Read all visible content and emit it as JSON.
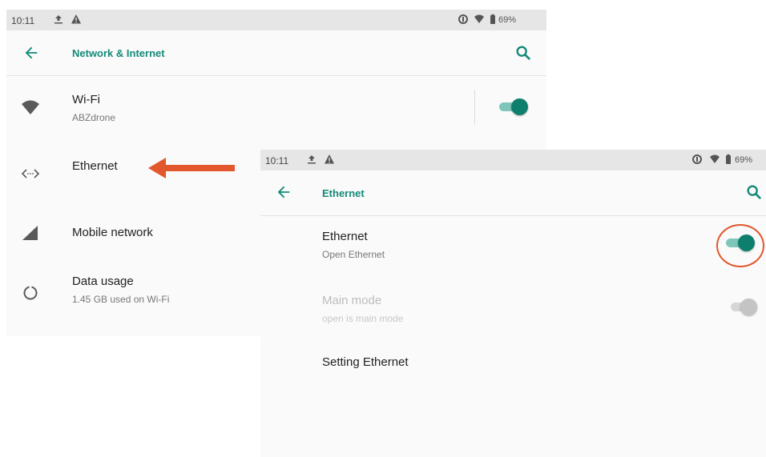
{
  "colors": {
    "accent": "#138a78",
    "switch_on": "#0e7f6d",
    "annotation": "#e2572b"
  },
  "screen1": {
    "status": {
      "time": "10:11",
      "battery": "69%"
    },
    "toolbar": {
      "title": "Network & Internet",
      "back_icon": "arrow-back-icon",
      "search_icon": "search-icon"
    },
    "items": [
      {
        "title": "Wi-Fi",
        "subtitle": "ABZdrone",
        "icon": "wifi-icon",
        "switch": "on"
      },
      {
        "title": "Ethernet",
        "subtitle": "",
        "icon": "ethernet-icon"
      },
      {
        "title": "Mobile network",
        "subtitle": "",
        "icon": "signal-icon"
      },
      {
        "title": "Data usage",
        "subtitle": "1.45 GB used on Wi-Fi",
        "icon": "data-usage-icon"
      }
    ]
  },
  "screen2": {
    "status": {
      "time": "10:11",
      "battery": "69%"
    },
    "toolbar": {
      "title": "Ethernet",
      "back_icon": "arrow-back-icon",
      "search_icon": "search-icon"
    },
    "items": [
      {
        "title": "Ethernet",
        "subtitle": "Open Ethernet",
        "switch": "on",
        "enabled": true
      },
      {
        "title": "Main mode",
        "subtitle": "open is main mode",
        "switch": "off",
        "enabled": false
      },
      {
        "title": "Setting Ethernet",
        "subtitle": ""
      }
    ]
  },
  "annotations": {
    "arrow": "arrow-left-annotation",
    "circle": "highlight-circle-annotation"
  }
}
